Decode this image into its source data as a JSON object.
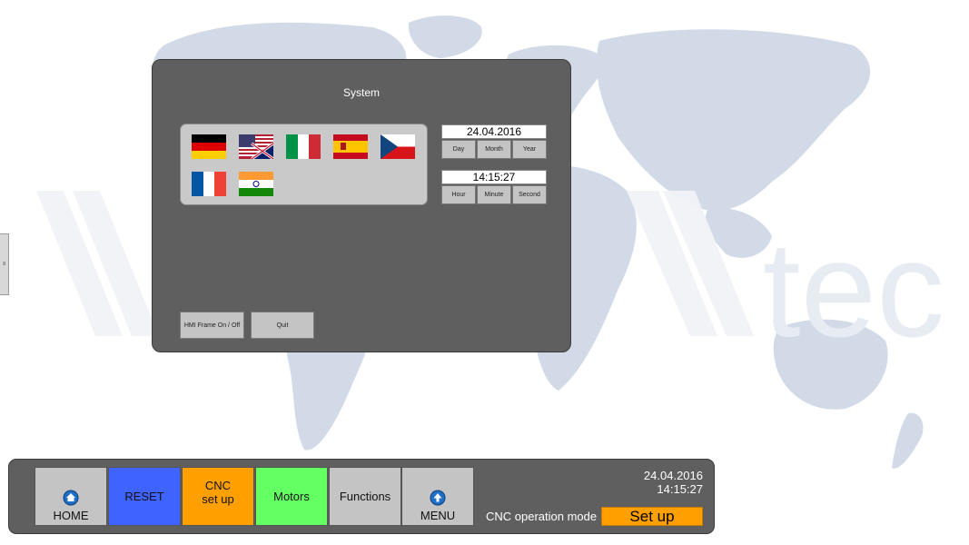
{
  "background": {
    "watermark_text": "tec",
    "map_color": "#d3dae7"
  },
  "side_tab": {
    "glyph": "≡"
  },
  "system_panel": {
    "title": "System",
    "languages": [
      {
        "name": "german-flag-icon"
      },
      {
        "name": "uk-us-flag-icon"
      },
      {
        "name": "italian-flag-icon"
      },
      {
        "name": "spanish-flag-icon"
      },
      {
        "name": "czech-flag-icon"
      },
      {
        "name": "french-flag-icon"
      },
      {
        "name": "indian-flag-icon"
      }
    ],
    "date_value": "24.04.2016",
    "date_buttons": [
      "Day",
      "Month",
      "Year"
    ],
    "time_value": "14:15:27",
    "time_buttons": [
      "Hour",
      "Minute",
      "Second"
    ],
    "hmi_frame_label": "HMI Frame On / Off",
    "quit_label": "Quit"
  },
  "nav_bar": {
    "buttons": [
      {
        "label": "HOME",
        "color": "#c4c4c4",
        "icon": "home-icon"
      },
      {
        "label": "RESET",
        "color": "#3f63ff"
      },
      {
        "label": "CNC\nset up",
        "color": "#ff9f00"
      },
      {
        "label": "Motors",
        "color": "#63ff63"
      },
      {
        "label": "Functions",
        "color": "#c4c4c4"
      },
      {
        "label": "MENU",
        "color": "#c4c4c4",
        "icon": "menu-up-icon"
      }
    ],
    "date": "24.04.2016",
    "time": "14:15:27",
    "operation_mode_label": "CNC operation mode",
    "operation_mode_value": "Set up"
  }
}
